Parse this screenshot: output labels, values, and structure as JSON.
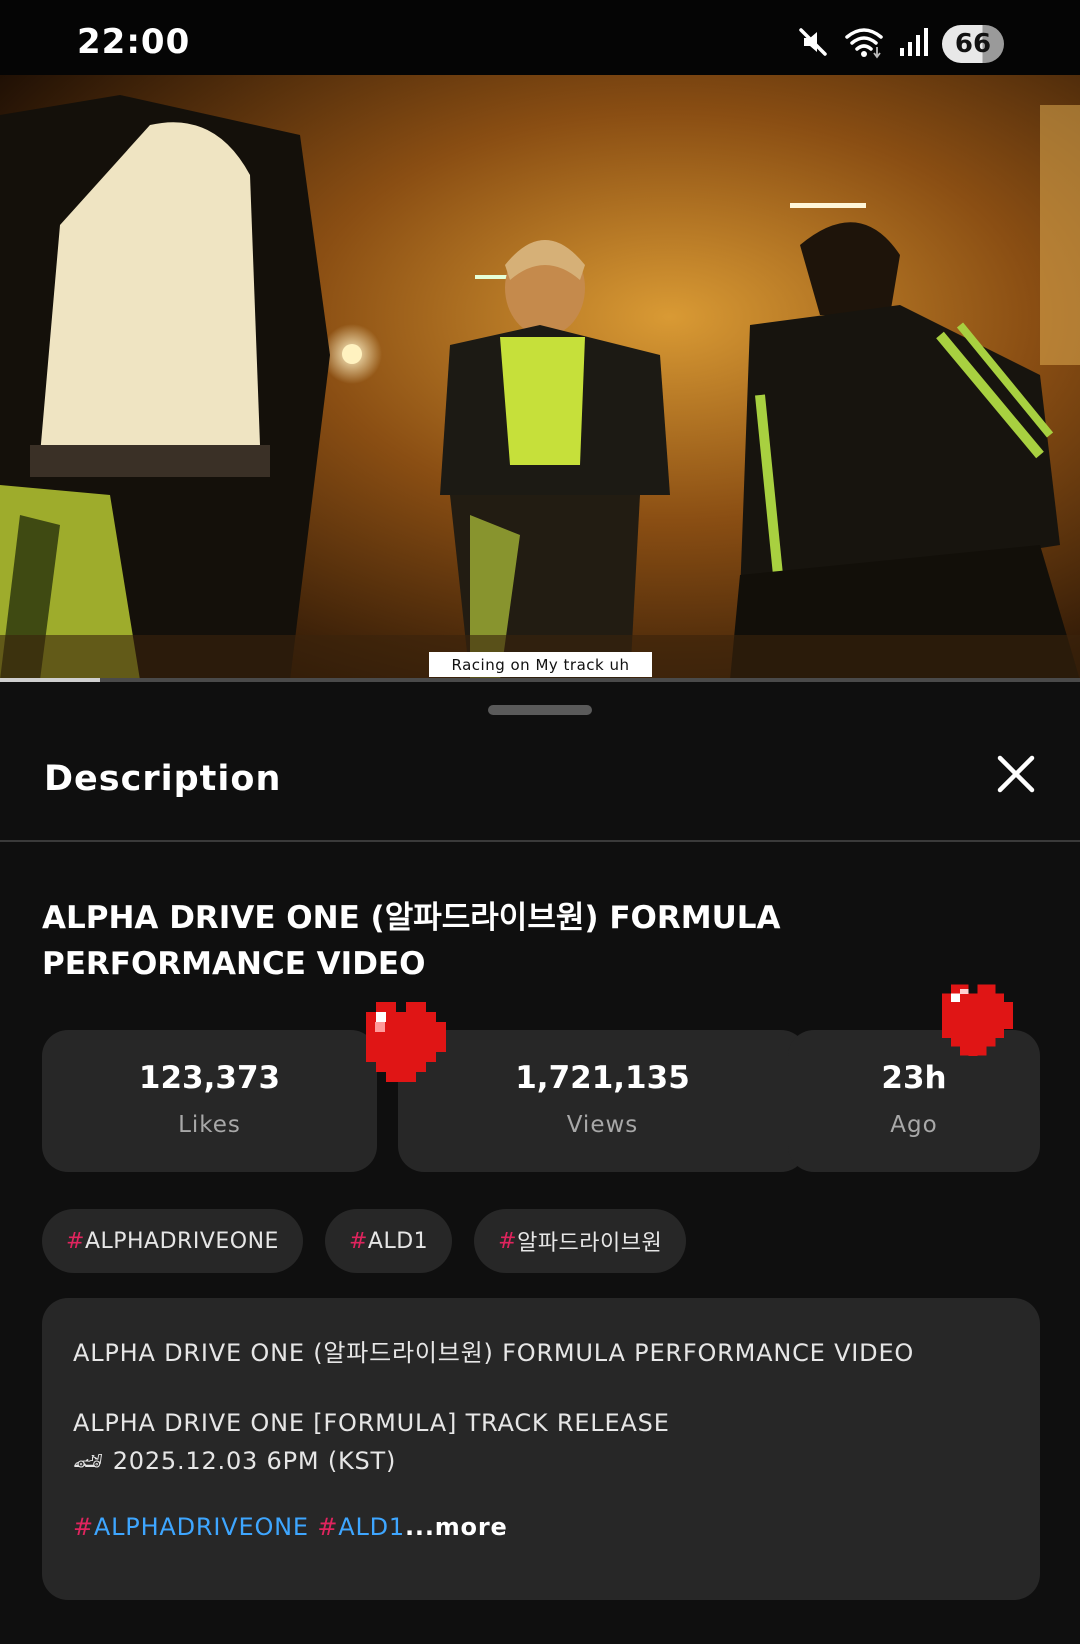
{
  "status_bar": {
    "time": "22:00",
    "battery": "66",
    "icons": [
      "mute-icon",
      "wifi-icon",
      "signal-icon"
    ]
  },
  "video": {
    "caption": "Racing on My track uh",
    "progress": 0.093
  },
  "sheet": {
    "title": "Description",
    "close_icon": "close-icon"
  },
  "video_title": "ALPHA DRIVE ONE (알파드라이브원)  FORMULA PERFORMANCE VIDEO",
  "stats": [
    {
      "value": "123,373",
      "label": "Likes"
    },
    {
      "value": "1,721,135",
      "label": "Views"
    },
    {
      "value": "23h",
      "label": "Ago"
    }
  ],
  "tags": [
    {
      "hash": "#",
      "text": "ALPHADRIVEONE"
    },
    {
      "hash": "#",
      "text": "ALD1"
    },
    {
      "hash": "#",
      "text": "알파드라이브원"
    }
  ],
  "description": {
    "line1": "ALPHA DRIVE ONE (알파드라이브원)  FORMULA PERFORMANCE VIDEO",
    "line2": "ALPHA DRIVE ONE [FORMULA] TRACK RELEASE",
    "line3": "🏎 2025.12.03 6PM (KST)",
    "tag1_hash": "#",
    "tag1": "ALPHADRIVEONE",
    "tag2_hash": "#",
    "tag2": "ALD1",
    "more": "...more"
  },
  "colors": {
    "background": "#0f0f0f",
    "card": "#272727",
    "hashtag_accent": "#e0245e",
    "link": "#3ea6ff",
    "heart": "#e01515"
  }
}
